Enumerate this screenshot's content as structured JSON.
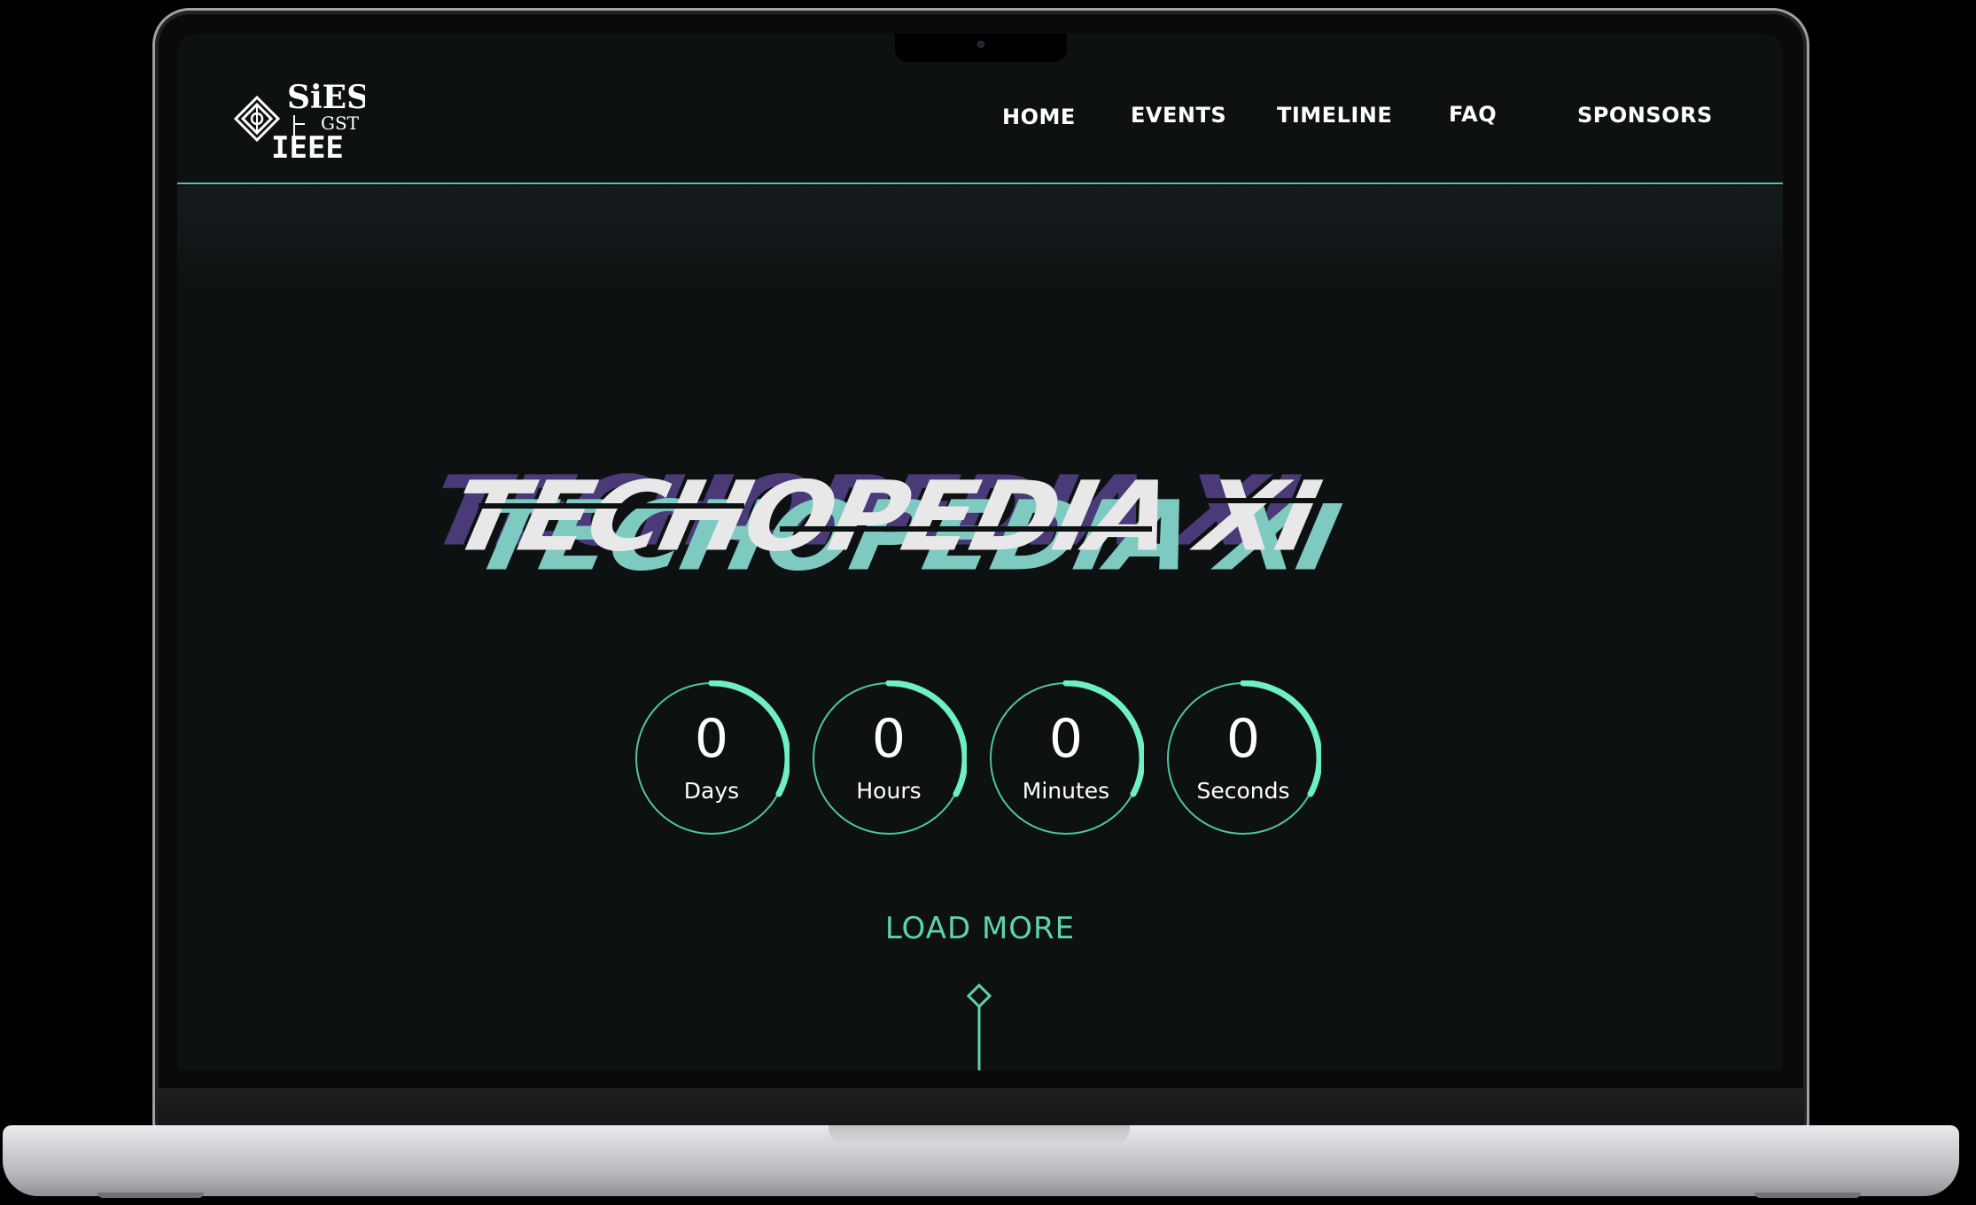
{
  "logo": {
    "text_top": "SiES",
    "text_sub": "GST",
    "text_bottom": "IEEE"
  },
  "nav": {
    "items": [
      {
        "label": "HOME"
      },
      {
        "label": "EVENTS"
      },
      {
        "label": "TIMELINE"
      },
      {
        "label": "FAQ"
      },
      {
        "label": "SPONSORS"
      }
    ]
  },
  "hero": {
    "title": "TECHOPEDIA XI"
  },
  "countdown": {
    "items": [
      {
        "value": "0",
        "label": "Days"
      },
      {
        "value": "0",
        "label": "Hours"
      },
      {
        "value": "0",
        "label": "Minutes"
      },
      {
        "value": "0",
        "label": "Seconds"
      }
    ]
  },
  "load_more": {
    "label": "LOAD MORE"
  },
  "colors": {
    "accent": "#5fd3ad",
    "background": "#0e1112",
    "title_shadow_purple": "#4a3a78",
    "title_shadow_teal": "#7ec9c0"
  },
  "icons": {
    "logo": "sies-ieee-logo-icon",
    "scroll": "diamond-scroll-indicator-icon"
  }
}
